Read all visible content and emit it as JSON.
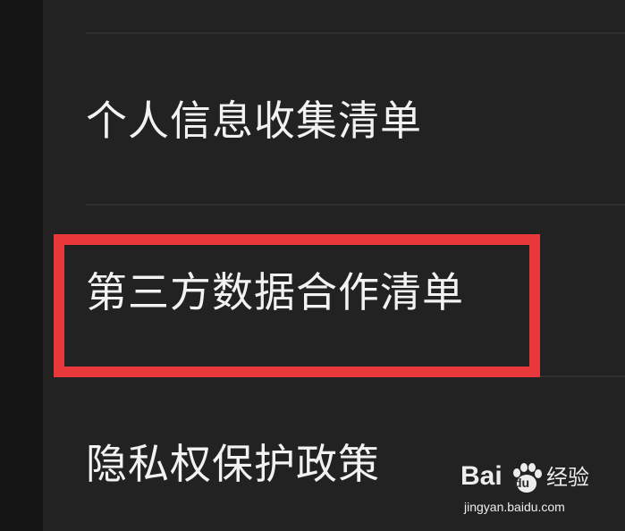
{
  "menu": {
    "items": [
      {
        "label": "个人信息收集清单"
      },
      {
        "label": "第三方数据合作清单",
        "highlighted": true
      },
      {
        "label": "隐私权保护政策"
      }
    ]
  },
  "highlight": {
    "color": "#e8383c"
  },
  "watermark": {
    "brand_prefix": "Bai",
    "brand_du": "du",
    "brand_suffix": "经验",
    "url": "jingyan.baidu.com",
    "icon": "paw-icon"
  },
  "colors": {
    "background": "#222222",
    "left_strip": "#141414",
    "divider": "#2f2f2f",
    "text": "#f2f2f2"
  }
}
